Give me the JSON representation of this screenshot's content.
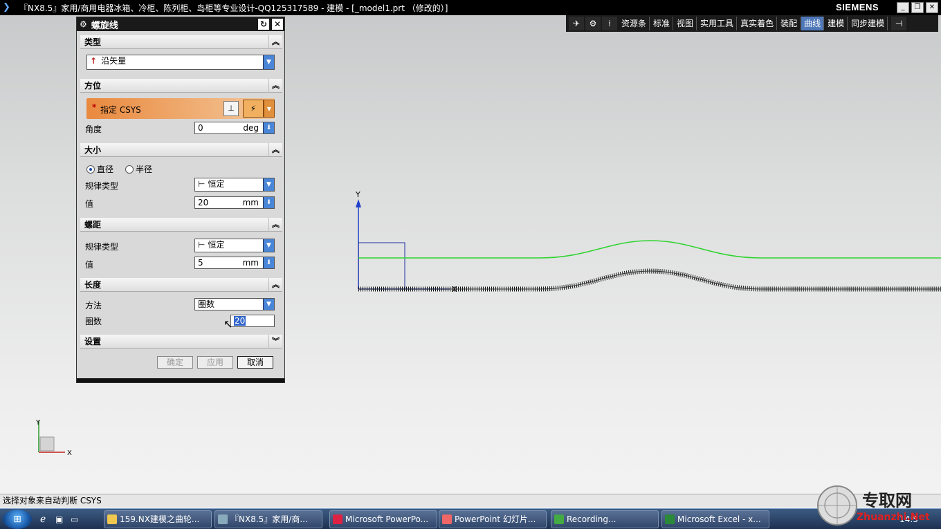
{
  "window": {
    "title": "『NX8.5』家用/商用电器冰箱、冷柜、陈列柜、岛柜等专业设计-QQ125317589 - 建模 - [_model1.prt （修改的）]",
    "brand": "SIEMENS",
    "buttons": [
      "_",
      "❐",
      "✕"
    ]
  },
  "toolbar": {
    "items": [
      "资源条",
      "标准",
      "视图",
      "实用工具",
      "真实着色",
      "装配",
      "曲线",
      "建模",
      "同步建模"
    ],
    "active": "曲线"
  },
  "dialog": {
    "title": "螺旋线",
    "type": {
      "header": "类型",
      "value": "沿矢量"
    },
    "orientation": {
      "header": "方位",
      "csys_label": "指定 CSYS",
      "angle_label": "角度",
      "angle_value": "0",
      "angle_unit": "deg"
    },
    "size": {
      "header": "大小",
      "radio_diameter": "直径",
      "radio_radius": "半径",
      "law_label": "规律类型",
      "law_value": "恒定",
      "value_label": "值",
      "value": "20",
      "unit": "mm"
    },
    "pitch": {
      "header": "螺距",
      "law_label": "规律类型",
      "law_value": "恒定",
      "value_label": "值",
      "value": "5",
      "unit": "mm"
    },
    "length": {
      "header": "长度",
      "method_label": "方法",
      "method_value": "圈数",
      "turns_label": "圈数",
      "turns_value": "20"
    },
    "settings": {
      "header": "设置"
    },
    "ok": "确定",
    "apply": "应用",
    "cancel": "取消"
  },
  "viewport": {
    "axis_y": "Y",
    "axis_x": "X",
    "triad_y": "Y",
    "triad_x": "X"
  },
  "status": {
    "text": "选择对象来自动判断 CSYS"
  },
  "taskbar": {
    "tasks": [
      "159.NX建模之曲轮...",
      "『NX8.5』家用/商...",
      "Microsoft PowerPo...",
      "PowerPoint 幻灯片...",
      "Recording...",
      "Microsoft Excel - x..."
    ],
    "clock": "14:5"
  },
  "watermark": {
    "cn": "专取网",
    "url": "Zhuanzhi.Net"
  },
  "colors": {
    "green_curve": "#2fd42f",
    "helix": "#111111",
    "axis": "#1f3fcc",
    "accent": "#4f78b8"
  }
}
